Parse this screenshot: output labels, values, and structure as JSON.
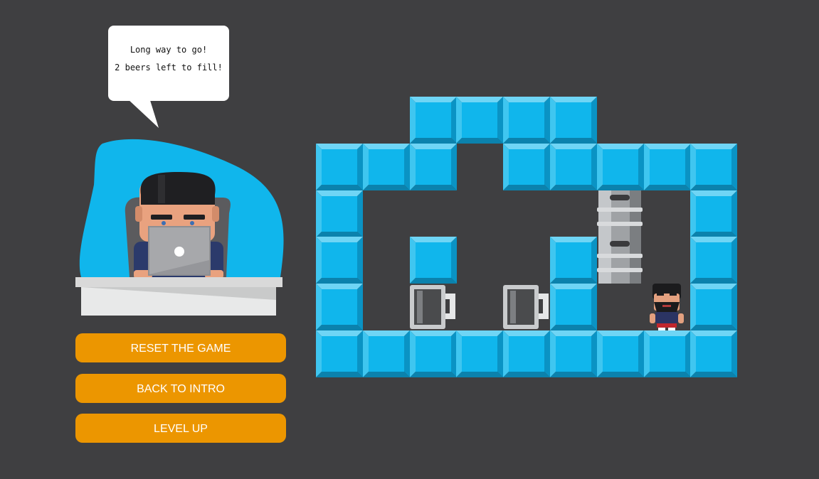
{
  "speech": {
    "line1": "Long way to go!",
    "line2": "2 beers left to fill!"
  },
  "buttons": {
    "reset": "RESET THE GAME",
    "intro": "BACK TO INTRO",
    "level_up": "LEVEL UP"
  },
  "colors": {
    "background": "#3f3f41",
    "wall": "#10b6ec",
    "button": "#ec9600",
    "character_blob": "#10b6ec"
  },
  "board": {
    "columns": 9,
    "rows": 6,
    "grid": [
      "..####...",
      "###.#####",
      "#.....K.#",
      "#.#..#K.#",
      "#.M.M#.P#",
      "#########"
    ],
    "legend": {
      "#": "wall-block",
      "K": "beer-keg",
      "M": "empty-beer-mug",
      "P": "player-bearded-man",
      ".": "floor"
    }
  }
}
